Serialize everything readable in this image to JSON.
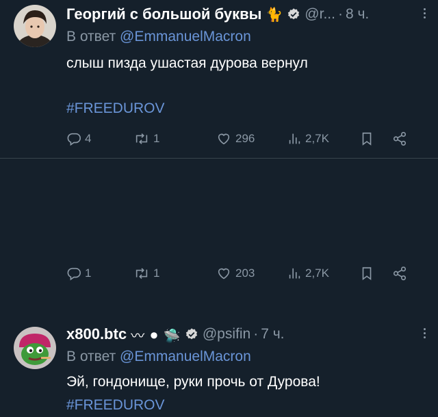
{
  "tweets": [
    {
      "author_name": "Георгий с большой буквы",
      "author_emoji": "🐈",
      "handle": "@r...",
      "time": "8 ч.",
      "reply_prefix": "В ответ",
      "reply_to": "@EmmanuelMacron",
      "text": "слыш пизда ушастая дурова вернул",
      "hashtag": "#FREEDUROV",
      "replies": "4",
      "retweets": "1",
      "likes": "296",
      "views": "2,7K"
    },
    {
      "author_name": "x800.btc",
      "author_emoji": "〰 ⚫ 🛸",
      "handle": "@psifin",
      "time": "7 ч.",
      "reply_prefix": "В ответ",
      "reply_to": "@EmmanuelMacron",
      "text": "Эй, гондонище, руки прочь от Дурова!",
      "hashtag": "#FREEDUROV",
      "replies": "1",
      "retweets": "1",
      "likes": "203",
      "views": "2,7K"
    }
  ],
  "colors": {
    "background": "#15202b",
    "secondary_text": "#8b98a5",
    "link": "#6a95d8",
    "verified": "#d8d8d8",
    "divider": "#38444d"
  },
  "icons": [
    "reply-icon",
    "retweet-icon",
    "like-icon",
    "views-icon",
    "bookmark-icon",
    "share-icon",
    "verified-badge-icon",
    "more-icon"
  ]
}
